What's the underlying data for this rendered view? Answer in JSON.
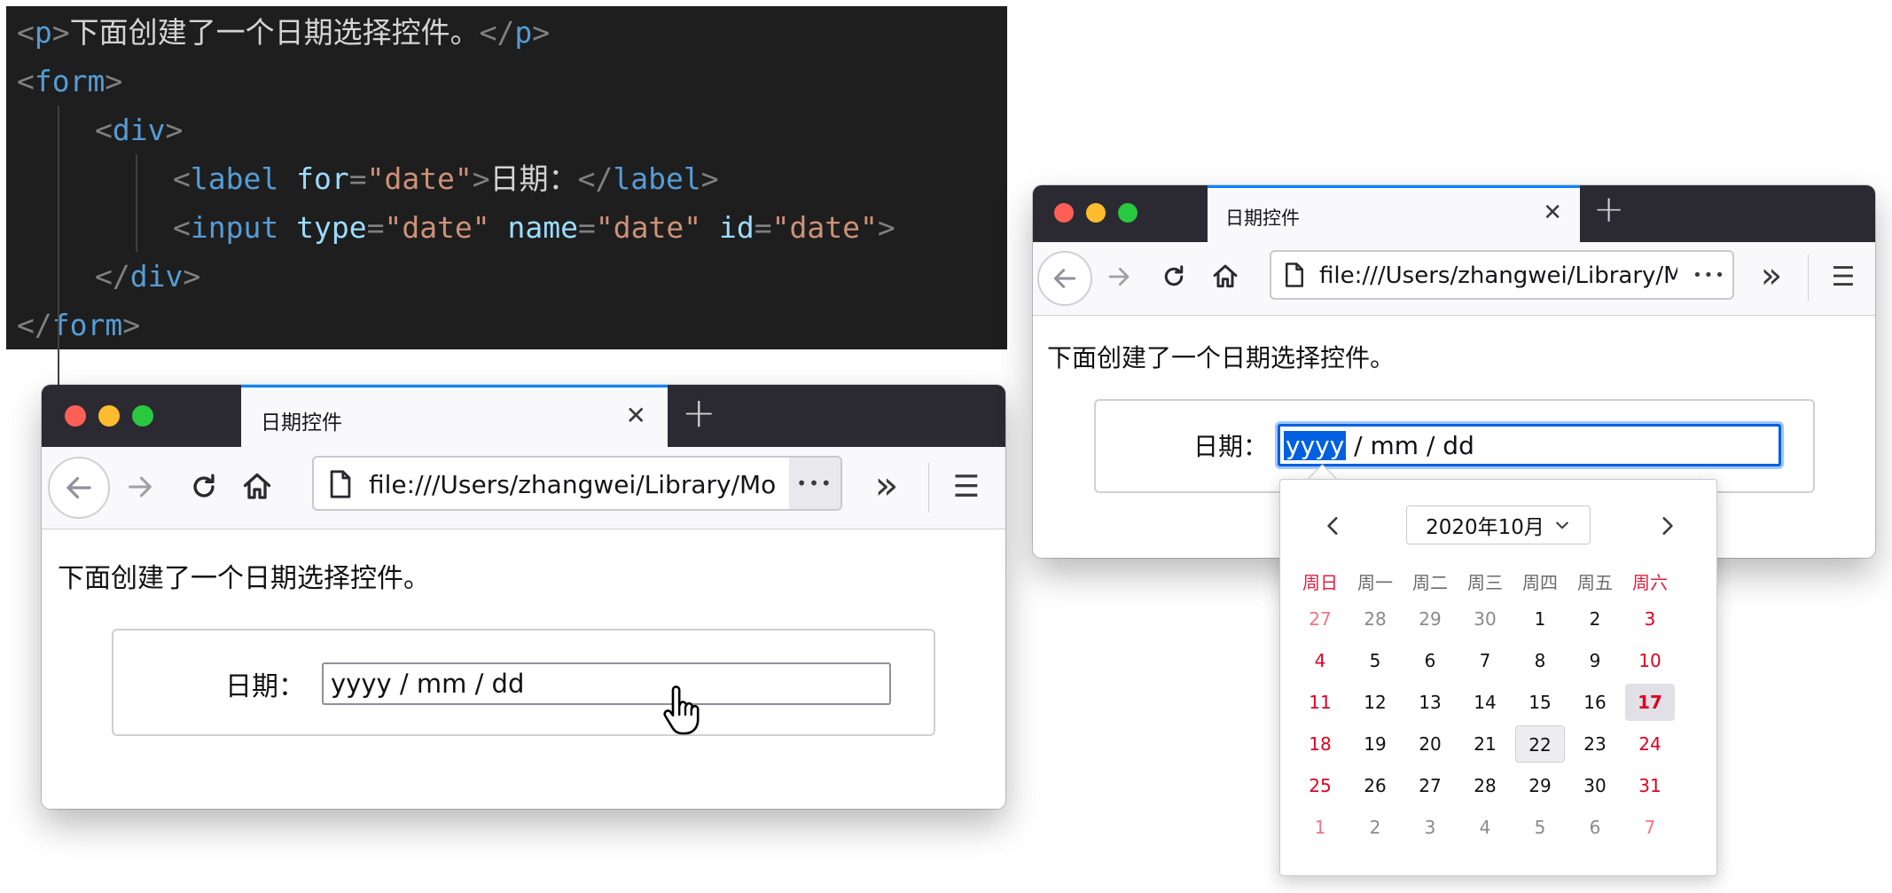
{
  "code": {
    "lines": [
      {
        "indent": 0,
        "tokens": [
          [
            "punct",
            "<"
          ],
          [
            "tag",
            "p"
          ],
          [
            "punct",
            ">"
          ],
          [
            "text",
            "下面创建了一个日期选择控件。"
          ],
          [
            "punct",
            "</"
          ],
          [
            "tag",
            "p"
          ],
          [
            "punct",
            ">"
          ]
        ]
      },
      {
        "indent": 0,
        "tokens": [
          [
            "punct",
            "<"
          ],
          [
            "tag",
            "form"
          ],
          [
            "punct",
            ">"
          ]
        ]
      },
      {
        "indent": 1,
        "tokens": [
          [
            "punct",
            "<"
          ],
          [
            "tag",
            "div"
          ],
          [
            "punct",
            ">"
          ]
        ]
      },
      {
        "indent": 2,
        "tokens": [
          [
            "punct",
            "<"
          ],
          [
            "tag",
            "label"
          ],
          [
            "plain",
            " "
          ],
          [
            "attr",
            "for"
          ],
          [
            "punct",
            "="
          ],
          [
            "str",
            "\"date\""
          ],
          [
            "punct",
            ">"
          ],
          [
            "text",
            "日期："
          ],
          [
            "punct",
            "</"
          ],
          [
            "tag",
            "label"
          ],
          [
            "punct",
            ">"
          ]
        ]
      },
      {
        "indent": 2,
        "tokens": [
          [
            "punct",
            "<"
          ],
          [
            "tag",
            "input"
          ],
          [
            "plain",
            " "
          ],
          [
            "attr",
            "type"
          ],
          [
            "punct",
            "="
          ],
          [
            "str",
            "\"date\""
          ],
          [
            "plain",
            " "
          ],
          [
            "attr",
            "name"
          ],
          [
            "punct",
            "="
          ],
          [
            "str",
            "\"date\""
          ],
          [
            "plain",
            " "
          ],
          [
            "attr",
            "id"
          ],
          [
            "punct",
            "="
          ],
          [
            "str",
            "\"date\""
          ],
          [
            "punct",
            ">"
          ]
        ]
      },
      {
        "indent": 1,
        "tokens": [
          [
            "punct",
            "</"
          ],
          [
            "tag",
            "div"
          ],
          [
            "punct",
            ">"
          ]
        ]
      },
      {
        "indent": 0,
        "tokens": [
          [
            "punct",
            "</"
          ],
          [
            "tag",
            "form"
          ],
          [
            "punct",
            ">"
          ]
        ]
      }
    ]
  },
  "browser": {
    "tab_title": "日期控件",
    "close_glyph": "✕",
    "newtab_glyph": "+",
    "url": "file:///Users/zhangwei/Library/Mobile Documents",
    "url_more": "•••",
    "overflow_glyph": "»",
    "menu_glyph": "☰",
    "paragraph": "下面创建了一个日期选择控件。",
    "label": "日期：",
    "colors": {
      "close": "#ff5f57",
      "minimize": "#febc2e",
      "zoom": "#28c840",
      "tab_accent": "#0a84ff"
    }
  },
  "window_left": {
    "date_value": "yyyy / mm / dd"
  },
  "window_right": {
    "date_year": "yyyy",
    "date_rest": " / mm / dd"
  },
  "calendar": {
    "month_label": "2020年10月",
    "weekdays": [
      "周日",
      "周一",
      "周二",
      "周三",
      "周四",
      "周五",
      "周六"
    ],
    "weeks": [
      [
        27,
        28,
        29,
        30,
        1,
        2,
        3
      ],
      [
        4,
        5,
        6,
        7,
        8,
        9,
        10
      ],
      [
        11,
        12,
        13,
        14,
        15,
        16,
        17
      ],
      [
        18,
        19,
        20,
        21,
        22,
        23,
        24
      ],
      [
        25,
        26,
        27,
        28,
        29,
        30,
        31
      ],
      [
        1,
        2,
        3,
        4,
        5,
        6,
        7
      ]
    ],
    "today": 17,
    "selected": 22
  }
}
